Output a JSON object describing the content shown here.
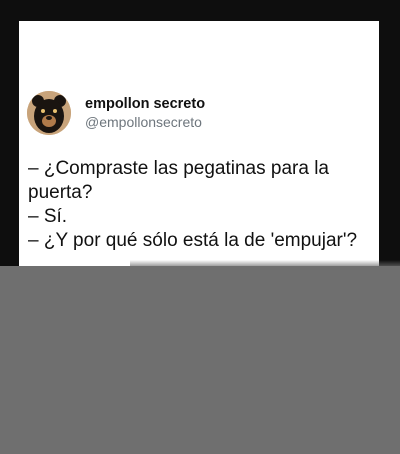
{
  "tweet": {
    "author": {
      "display_name": "empollon secreto",
      "handle": "@empollonsecreto",
      "avatar_icon": "bear-avatar-icon"
    },
    "lines": [
      "– ¿Compraste las pegatinas para la",
      "puerta?",
      "– Sí.",
      "– ¿Y por qué sólo está la de 'empujar'?"
    ]
  },
  "colors": {
    "background": "#0e0e0e",
    "card": "#ffffff",
    "text": "#111111",
    "handle": "#6e767d",
    "overlay": "#6f6f6f"
  }
}
